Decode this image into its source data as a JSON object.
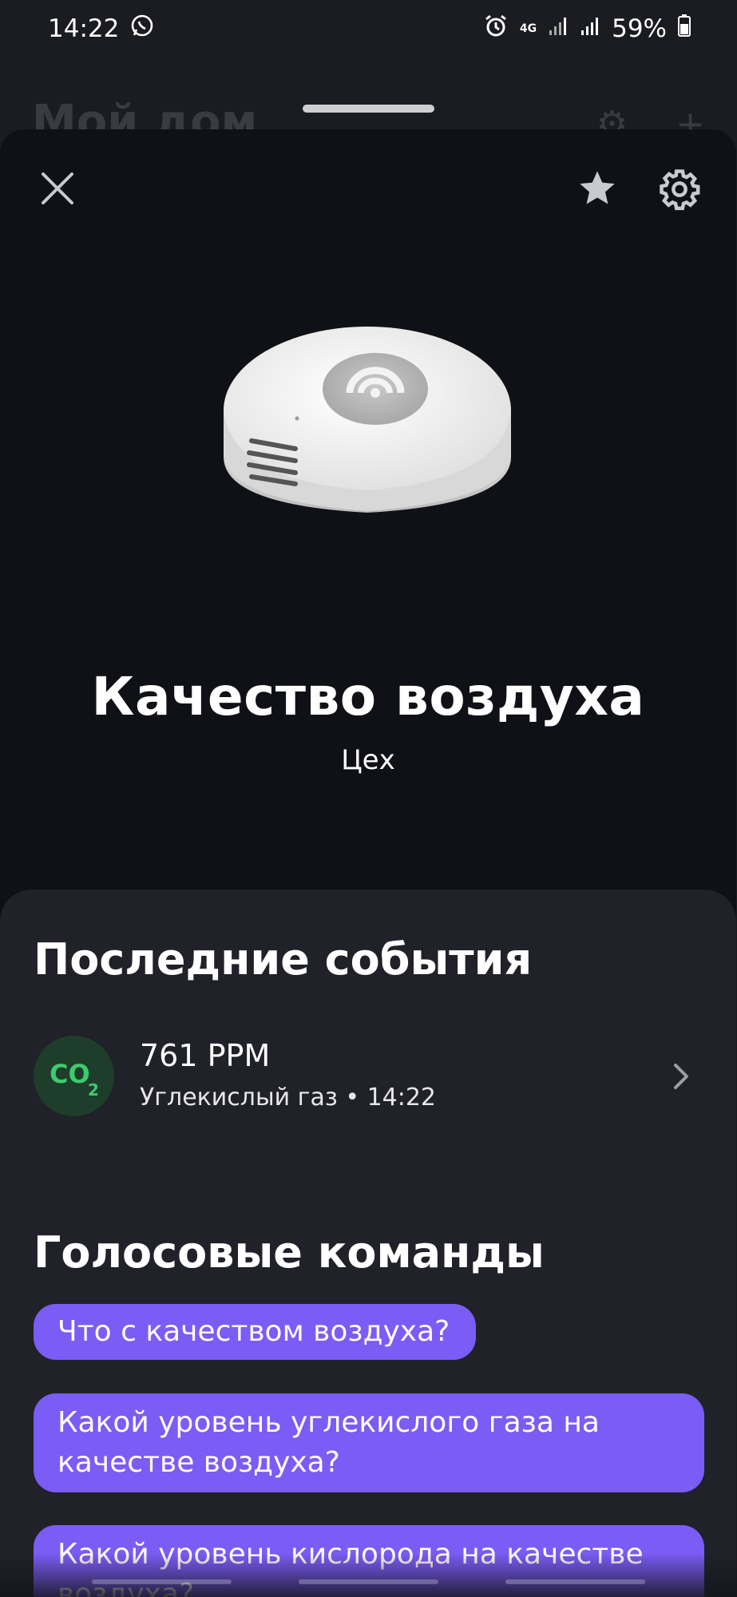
{
  "status_bar": {
    "time": "14:22",
    "battery": "59%",
    "network": "4G"
  },
  "background_app": {
    "title": "Мой дом"
  },
  "sheet": {
    "device_title": "Качество воздуха",
    "device_room": "Цех"
  },
  "events": {
    "title": "Последние события",
    "items": [
      {
        "value": "761 PPM",
        "label": "Углекислый газ",
        "time": "14:22",
        "icon": "co2-icon",
        "icon_color": "#3ecb6d"
      }
    ]
  },
  "voice_commands": {
    "title": "Голосовые команды",
    "items": [
      "Что с качеством воздуха?",
      "Какой уровень углекислого газа на качестве воздуха?",
      "Какой уровень кислорода на качестве воздуха?"
    ]
  },
  "colors": {
    "accent": "#7b5cf5",
    "sheet_bg": "#0f1117",
    "card_bg": "#202129"
  }
}
